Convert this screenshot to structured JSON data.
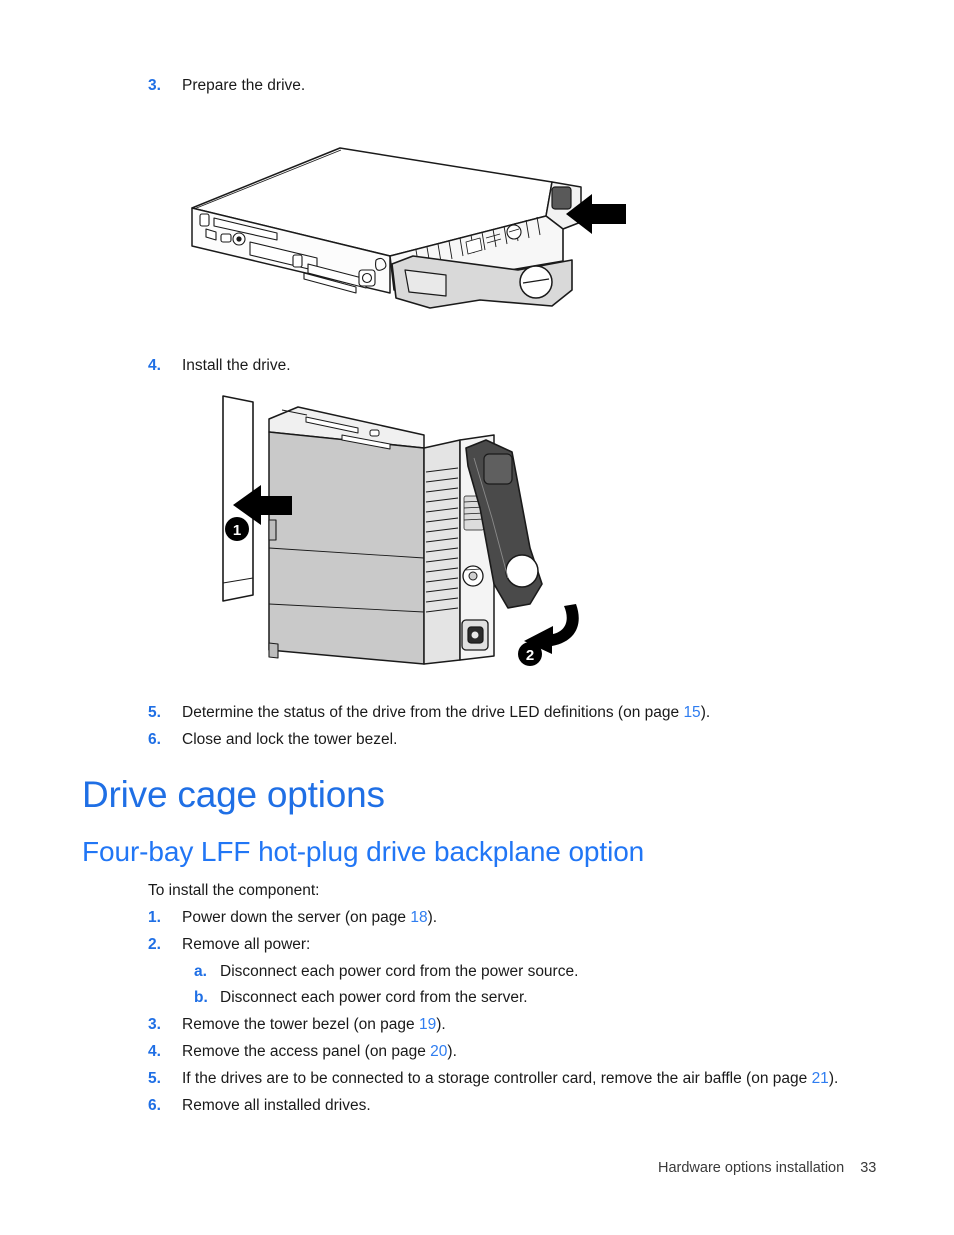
{
  "document": {
    "footer_text": "Hardware options installation",
    "page_number": "33",
    "accent_blue": "#2176f5",
    "xref_blue": "#2f7df0"
  },
  "top_steps": [
    {
      "num": "3.",
      "text": "Prepare the drive."
    },
    {
      "num": "4.",
      "text": "Install the drive."
    }
  ],
  "after_steps": [
    {
      "num": "5.",
      "pre": "Determine the status of the drive from the drive LED definitions (on page ",
      "xref": "15",
      "post": ")."
    },
    {
      "num": "6.",
      "pre": "Close and lock the tower bezel.",
      "xref": "",
      "post": ""
    }
  ],
  "headings": {
    "section": "Drive cage options",
    "subsection": "Four-bay LFF hot-plug drive backplane option"
  },
  "install_intro": "To install the component:",
  "install_steps": [
    {
      "num": "1.",
      "pre": "Power down the server (on page ",
      "xref": "18",
      "post": ")."
    },
    {
      "num": "2.",
      "pre": "Remove all power:",
      "xref": "",
      "post": ""
    },
    {
      "num": "3.",
      "pre": "Remove the tower bezel (on page ",
      "xref": "19",
      "post": ")."
    },
    {
      "num": "4.",
      "pre": "Remove the access panel (on page ",
      "xref": "20",
      "post": ")."
    },
    {
      "num": "5.",
      "pre": "If the drives are to be connected to a storage controller card, remove the air baffle (on page ",
      "xref": "21",
      "post": ")."
    },
    {
      "num": "6.",
      "pre": "Remove all installed drives.",
      "xref": "",
      "post": ""
    }
  ],
  "install_substeps": [
    {
      "num": "a.",
      "text": "Disconnect each power cord from the power source."
    },
    {
      "num": "b.",
      "text": "Disconnect each power cord from the server."
    }
  ],
  "figures": {
    "prepare_drive": {
      "caption_ref": "3",
      "description": "Isometric line drawing of a hot-plug hard drive carrier lying flat with its release latch swung open; a solid black arrow at the right points left toward the latch release button.",
      "callouts": [],
      "arrow_direction": "left"
    },
    "install_drive": {
      "caption_ref": "4",
      "description": "Line drawing of a hot-plug drive carrier standing upright being slid into an open drive bay; callout 1 is a left-pointing arrow into the bay and callout 2 is a curved arrow showing the latch rotating closed.",
      "callouts": [
        {
          "label": "1",
          "meaning": "slide drive into bay"
        },
        {
          "label": "2",
          "meaning": "rotate latch closed"
        }
      ]
    }
  }
}
